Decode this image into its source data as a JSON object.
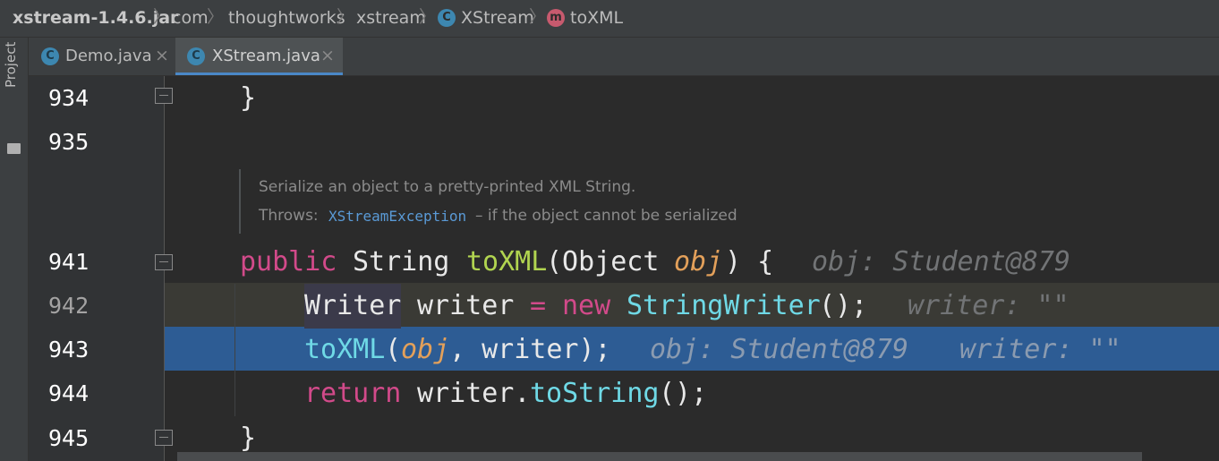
{
  "breadcrumbs": {
    "jar": "xstream-1.4.6.jar",
    "pkg1": "com",
    "pkg2": "thoughtworks",
    "pkg3": "xstream",
    "class_icon": "C",
    "class_name": "XStream",
    "method_icon": "m",
    "method_name": "toXML",
    "separator": "〉"
  },
  "sidebar": {
    "project_label": "Project"
  },
  "tabs": [
    {
      "label": "Demo.java",
      "icon": "C",
      "close": "×"
    },
    {
      "label": "XStream.java",
      "icon": "C",
      "close": "×"
    }
  ],
  "editor": {
    "line_numbers": {
      "l934": "934",
      "l935": "935",
      "l941": "941",
      "l942": "942",
      "l943": "943",
      "l944": "944",
      "l945": "945"
    },
    "code": {
      "l934_brace": "}",
      "l941_public": "public",
      "l941_string": "String",
      "l941_method": "toXML",
      "l941_open": "(Object",
      "l941_param": "obj",
      "l941_close": ") {",
      "l941_hint": "obj: Student@879",
      "l942_writer_type": "Writer",
      "l942_var": "writer",
      "l942_eq": "=",
      "l942_new": "new",
      "l942_ctor": "StringWriter",
      "l942_end": "();",
      "l942_hint": "writer: \"\"",
      "l943_call": "toXML",
      "l943_open": "(",
      "l943_arg": "obj",
      "l943_rest": ", writer);",
      "l943_hint1": "obj: Student@879",
      "l943_hint2": "writer: \"\"",
      "l944_return": "return",
      "l944_obj": "writer.",
      "l944_call": "toString",
      "l944_end": "();",
      "l945_brace": "}"
    },
    "doc": {
      "line1": "Serialize an object to a pretty-printed XML String.",
      "throws_label": "Throws:",
      "exception": "XStreamException",
      "throws_desc": "– if the object cannot be serialized"
    }
  },
  "colors": {
    "keyword": "#d24a8a",
    "method": "#b1d450",
    "call": "#6fd9e6",
    "param": "#e3a05a",
    "execution_line": "#2d5c94",
    "current_line": "#3a3a35"
  }
}
